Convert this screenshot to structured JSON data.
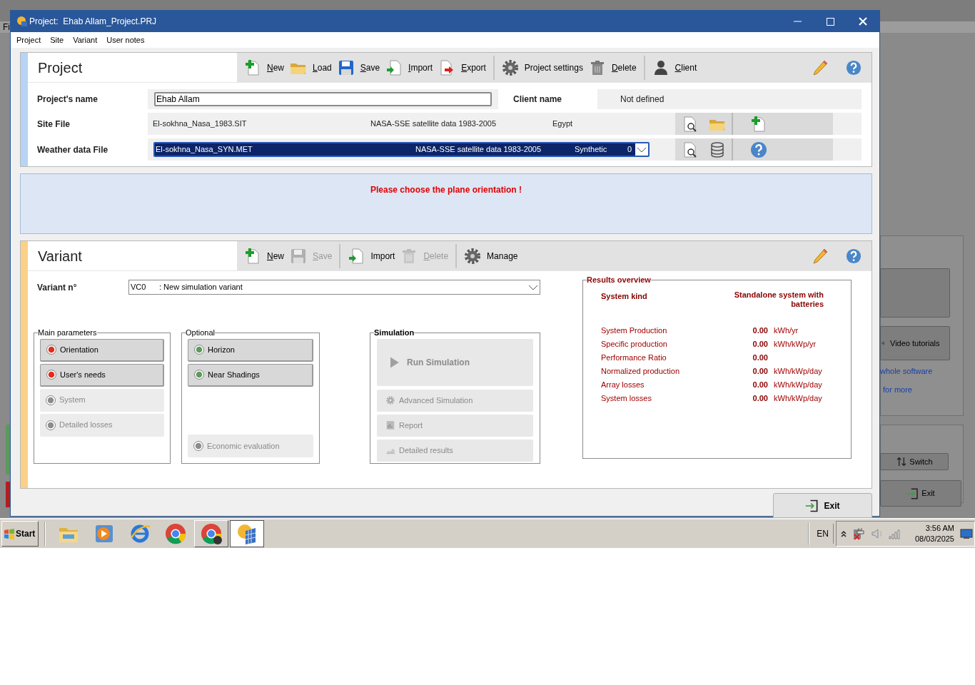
{
  "background_window": {
    "menu": [
      "Fi"
    ],
    "buttons": [
      "Video tutorials"
    ],
    "links": [
      "whole software",
      "for more"
    ],
    "lower_buttons": [
      "Switch",
      "Exit"
    ]
  },
  "window": {
    "title": "Project:  Ehab Allam_Project.PRJ"
  },
  "menu": [
    "Project",
    "Site",
    "Variant",
    "User notes"
  ],
  "project": {
    "heading": "Project",
    "toolbar": [
      [
        {
          "label": "New",
          "mnemonic": true,
          "disabled": false
        },
        {
          "label": "Load",
          "mnemonic": true,
          "disabled": false
        },
        {
          "label": "Save",
          "mnemonic": true,
          "disabled": false
        },
        {
          "label": "Import",
          "mnemonic": true,
          "disabled": false
        },
        {
          "label": "Export",
          "mnemonic": true,
          "disabled": false
        }
      ],
      [
        {
          "label": "Project settings",
          "mnemonic": false,
          "disabled": false
        },
        {
          "label": "Delete",
          "mnemonic": true,
          "disabled": false
        }
      ],
      [
        {
          "label": "Client",
          "mnemonic": true,
          "disabled": false
        }
      ]
    ],
    "name_label": "Project's name",
    "name_value": "Ehab Allam",
    "client_label": "Client name",
    "client_value": "Not defined",
    "site_label": "Site File",
    "site_cells": [
      "El-sokhna_Nasa_1983.SIT",
      "NASA-SSE satellite data 1983-2005",
      "Egypt"
    ],
    "weather_label": "Weather data File",
    "weather_cells": [
      "El-sokhna_Nasa_SYN.MET",
      "NASA-SSE satellite data 1983-2005",
      "Synthetic",
      "0"
    ],
    "weather_selected": true
  },
  "message": "Please choose the plane orientation !",
  "variant": {
    "heading": "Variant",
    "toolbar": [
      [
        {
          "label": "New",
          "mnemonic": true,
          "disabled": false
        },
        {
          "label": "Save",
          "mnemonic": true,
          "disabled": true
        }
      ],
      [
        {
          "label": "Import",
          "mnemonic": false,
          "disabled": false
        },
        {
          "label": "Delete",
          "mnemonic": true,
          "disabled": true
        }
      ],
      [
        {
          "label": "Manage",
          "mnemonic": false,
          "disabled": false
        }
      ]
    ],
    "number_label": "Variant n°",
    "number_code": "VC0",
    "number_name": ": New simulation variant",
    "groups": [
      {
        "title": "Main parameters",
        "bold": false,
        "items": [
          {
            "kind": "status",
            "label": "Orientation",
            "color": "#e52a1a",
            "disabled": false
          },
          {
            "kind": "status",
            "label": "User's needs",
            "color": "#e52a1a",
            "disabled": false
          },
          {
            "kind": "status",
            "label": "System",
            "color": "#8c8c8c",
            "disabled": true
          },
          {
            "kind": "status",
            "label": "Detailed losses",
            "color": "#8c8c8c",
            "disabled": true
          }
        ]
      },
      {
        "title": "Optional",
        "bold": false,
        "items": [
          {
            "kind": "status",
            "label": "Horizon",
            "color": "#5e9a5e",
            "disabled": false
          },
          {
            "kind": "status",
            "label": "Near Shadings",
            "color": "#5e9a5e",
            "disabled": false
          }
        ],
        "bottom_items": [
          {
            "kind": "status",
            "label": "Economic evaluation",
            "color": "#8c8c8c",
            "disabled": true
          }
        ]
      },
      {
        "title": "Simulation",
        "bold": true,
        "items": [
          {
            "kind": "large",
            "label": "Run Simulation",
            "disabled": true
          },
          {
            "kind": "action",
            "label": "Advanced Simulation",
            "disabled": true
          },
          {
            "kind": "action",
            "label": "Report",
            "disabled": true
          },
          {
            "kind": "action",
            "label": "Detailed results",
            "disabled": true
          }
        ]
      }
    ],
    "results": {
      "title": "Results overview",
      "kind_label": "System kind",
      "kind_value": "Standalone system with batteries",
      "rows": [
        {
          "label": "System Production",
          "value": "0.00",
          "unit": "kWh/yr"
        },
        {
          "label": "Specific production",
          "value": "0.00",
          "unit": "kWh/kWp/yr"
        },
        {
          "label": "Performance Ratio",
          "value": "0.00"
        },
        {
          "label": "Normalized production",
          "value": "0.00",
          "unit": "kWh/kWp/day"
        },
        {
          "label": "Array losses",
          "value": "0.00",
          "unit": "kWh/kWp/day"
        },
        {
          "label": "System losses",
          "value": "0.00",
          "unit": "kWh/kWp/day"
        }
      ]
    }
  },
  "exit_button": "Exit",
  "taskbar": {
    "start": "Start",
    "apps": [
      {
        "open": false,
        "selected": false
      },
      {
        "open": false,
        "selected": false
      },
      {
        "open": false,
        "selected": false
      },
      {
        "open": false,
        "selected": false
      },
      {
        "open": true,
        "selected": false
      },
      {
        "open": true,
        "selected": true
      }
    ],
    "language": "EN",
    "time": "3:56 AM",
    "date": "08/03/2025"
  }
}
